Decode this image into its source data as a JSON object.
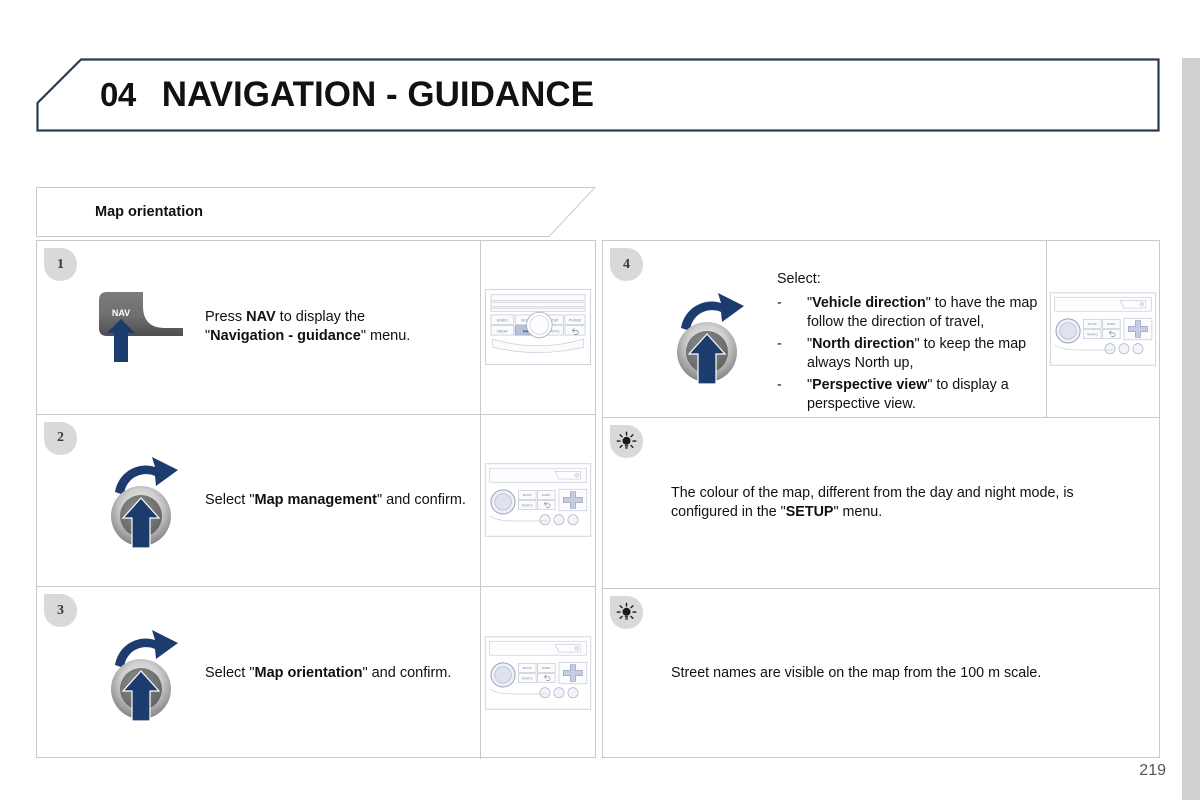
{
  "document": {
    "chapter_number": "04",
    "chapter_title": "NAVIGATION - GUIDANCE",
    "section_title": "Map orientation",
    "page_number": "219"
  },
  "colors": {
    "header_border": "#2a3c52",
    "arrow_blue": "#1d3c6e",
    "badge_gray": "#d9d9d9",
    "table_border": "#c9c9c9",
    "page_edge": "#d0d0d0"
  },
  "left_table": {
    "steps": [
      {
        "number": "1",
        "graphic": "nav-button-press-icon",
        "button_label": "NAV",
        "text_html": "Press <b>NAV</b> to display the<br>\"<b>Navigation - guidance</b>\" menu.",
        "device": "car-radio-faceplate-type-a"
      },
      {
        "number": "2",
        "graphic": "rotary-knob-turn-push-icon",
        "text_html": "Select \"<b>Map management</b>\" and confirm.",
        "device": "car-radio-faceplate-type-b"
      },
      {
        "number": "3",
        "graphic": "rotary-knob-turn-push-icon",
        "text_html": "Select \"<b>Map orientation</b>\" and confirm.",
        "device": "car-radio-faceplate-type-b"
      }
    ]
  },
  "right_table": {
    "step4": {
      "number": "4",
      "graphic": "rotary-knob-turn-push-icon",
      "lead": "Select:",
      "dash": "-",
      "options": [
        {
          "html": "\"<b>Vehicle direction</b>\" to have the map follow the direction of travel,"
        },
        {
          "html": "\"<b>North direction</b>\" to keep the map always North up,"
        },
        {
          "html": "\"<b>Perspective view</b>\" to display a perspective view."
        }
      ],
      "device": "car-radio-faceplate-type-b"
    },
    "notes": [
      {
        "icon": "light-bulb-tip-icon",
        "text_html": "The colour of the map, different from the day and night mode, is configured in the \"<b>SETUP</b>\" menu."
      },
      {
        "icon": "light-bulb-tip-icon",
        "text_html": "Street names are visible on the map from the 100 m scale."
      }
    ]
  },
  "radio_a": {
    "buttons_top": [
      "RADIO",
      "MUSIC",
      "SETUP",
      "PHONE"
    ],
    "buttons_bottom": [
      "MEDIA",
      "NAV",
      "TRAFFIC"
    ],
    "highlighted": "NAV"
  }
}
